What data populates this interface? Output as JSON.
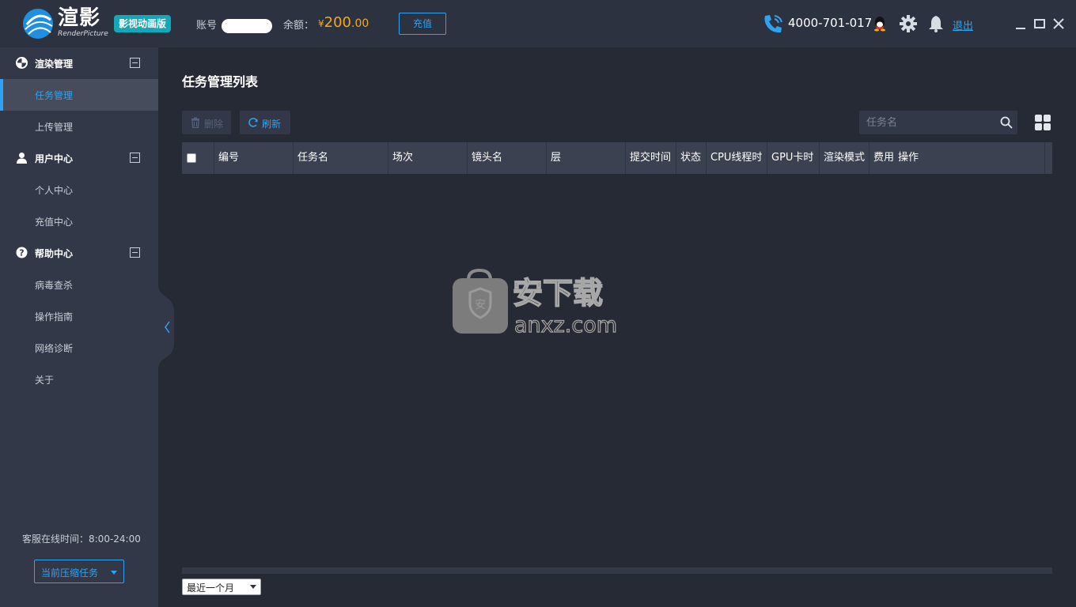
{
  "header": {
    "brand": "渲影",
    "brand_sub": "RenderPicture",
    "edition": "影视动画版",
    "account_label": "账号",
    "balance_label": "余额：",
    "balance_currency": "¥",
    "balance_int": "200",
    "balance_dec": ".00",
    "recharge_label": "充值",
    "phone": "4000-701-017",
    "logout_label": "退出",
    "icons": [
      "logo-icon",
      "phone-icon",
      "qq-icon",
      "gear-icon",
      "bell-icon",
      "minimize-icon",
      "maximize-icon",
      "close-icon"
    ]
  },
  "sidebar": {
    "groups": [
      {
        "label": "渲染管理",
        "icon": "render-icon",
        "items": [
          "任务管理",
          "上传管理"
        ]
      },
      {
        "label": "用户中心",
        "icon": "user-icon",
        "items": [
          "个人中心",
          "充值中心"
        ]
      },
      {
        "label": "帮助中心",
        "icon": "help-icon",
        "items": [
          "病毒查杀",
          "操作指南",
          "网络诊断",
          "关于"
        ]
      }
    ],
    "active_item": "任务管理",
    "service_time": "客服在线时间：8:00-24:00",
    "task_select": "当前压缩任务"
  },
  "main": {
    "title": "任务管理列表",
    "delete_label": "删除",
    "refresh_label": "刷新",
    "search_placeholder": "任务名",
    "columns": [
      "编号",
      "任务名",
      "场次",
      "镜头名",
      "层",
      "提交时间",
      "状态",
      "CPU线程时",
      "GPU卡时",
      "渲染模式",
      "费用",
      "操作"
    ],
    "period_select": "最近一个月"
  },
  "watermark": {
    "text_cn": "安下载",
    "text_en": "anxz.com"
  },
  "colors": {
    "accent": "#2ea3f2",
    "balance": "#f5a623",
    "edition_badge": "#13a7b8",
    "background": "#262a35",
    "sidebar": "#323847"
  }
}
